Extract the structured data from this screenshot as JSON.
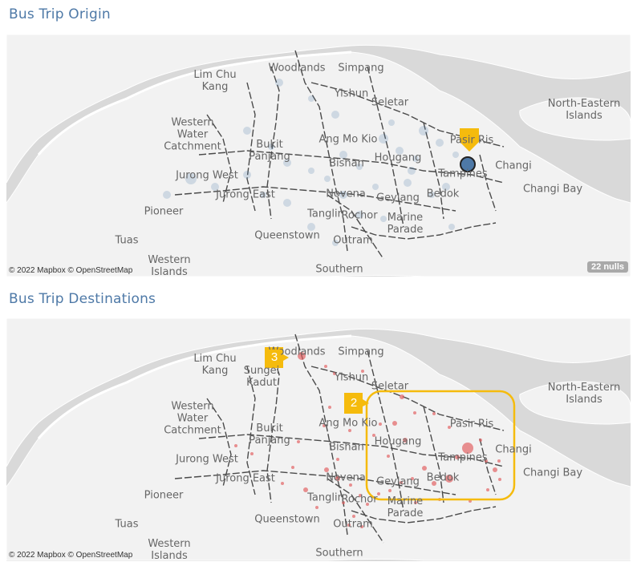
{
  "origin": {
    "title": "Bus Trip Origin",
    "attribution": "© 2022 Mapbox © OpenStreetMap",
    "nulls_badge": "22 nulls",
    "selected_point_color": "#4e79a7"
  },
  "destinations": {
    "title": "Bus Trip Destinations",
    "attribution": "© 2022 Mapbox © OpenStreetMap",
    "annotation_1": "3",
    "annotation_2": "2",
    "point_color": "#e15759",
    "highlight_color": "#f5bb0d"
  },
  "place_labels": {
    "woodlands": "Woodlands",
    "simpang": "Simpang",
    "lim_chu_kang": "Lim Chu\nKang",
    "yishun": "Yishun",
    "seletar": "Seletar",
    "north_eastern_islands": "North-Eastern\nIslands",
    "western_water_catchment": "Western\nWater\nCatchment",
    "bukit_panjang": "Bukit\nPanjang",
    "ang_mo_kio": "Ang Mo Kio",
    "pasir_ris": "Pasir Ris",
    "hougang": "Hougang",
    "bishan": "Bishan",
    "jurong_west": "Jurong West",
    "tampines": "Tampines",
    "changi": "Changi",
    "jurong_east": "Jurong East",
    "novena": "Novena",
    "geylang": "Geylang",
    "bedok": "Bedok",
    "changi_bay": "Changi Bay",
    "pioneer": "Pioneer",
    "tanglin": "Tanglin",
    "rochor": "Rochor",
    "marine_parade": "Marine\nParade",
    "tuas": "Tuas",
    "queenstown": "Queenstown",
    "outram": "Outram",
    "western_islands": "Western\nIslands",
    "southern": "Southern",
    "sungei_kadut": "Sungei\nKadut"
  }
}
